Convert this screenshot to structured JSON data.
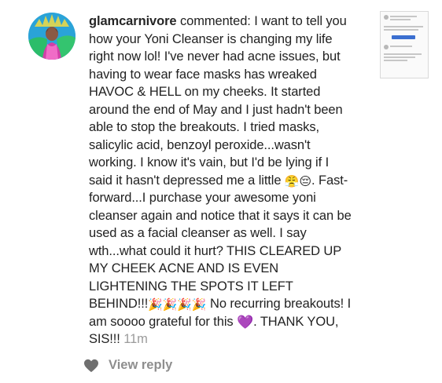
{
  "comment": {
    "username": "glamcarnivore",
    "segments": [
      " commented: I want to tell you how your Yoni Cleanser is changing my life right now lol! I've never had acne issues, but having to wear face masks has wreaked HAVOC & HELL on my cheeks. It started around the end of May and I just hadn't been able to stop the breakouts. I tried masks, salicylic acid, benzoyl peroxide...wasn't working. I know it's vain, but I'd be lying if I said it hasn't depressed me a little ",
      ". Fast-forward...I purchase your awesome yoni cleanser again and notice that it says it can be used as a facial cleanser as well. I say wth...what could it hurt? THIS CLEARED UP MY CHEEK ACNE AND IS EVEN LIGHTENING THE SPOTS IT LEFT BEHIND!!!",
      " No recurring breakouts! I am soooo grateful for this ",
      ". THANK YOU, SIS!!! "
    ],
    "emoji_pair": "😤😔",
    "party_emojis": "🎉🎉🎉🎉",
    "heart_emoji": "💜",
    "timestamp": "11m"
  },
  "actions": {
    "view_reply_label": "View reply"
  },
  "icons": {
    "view_reply_icon": "heart-icon"
  },
  "colors": {
    "text": "#222222",
    "muted": "#8e8e8e",
    "timestamp": "#9b9b9b",
    "heart_icon": "#6f6f6f"
  }
}
